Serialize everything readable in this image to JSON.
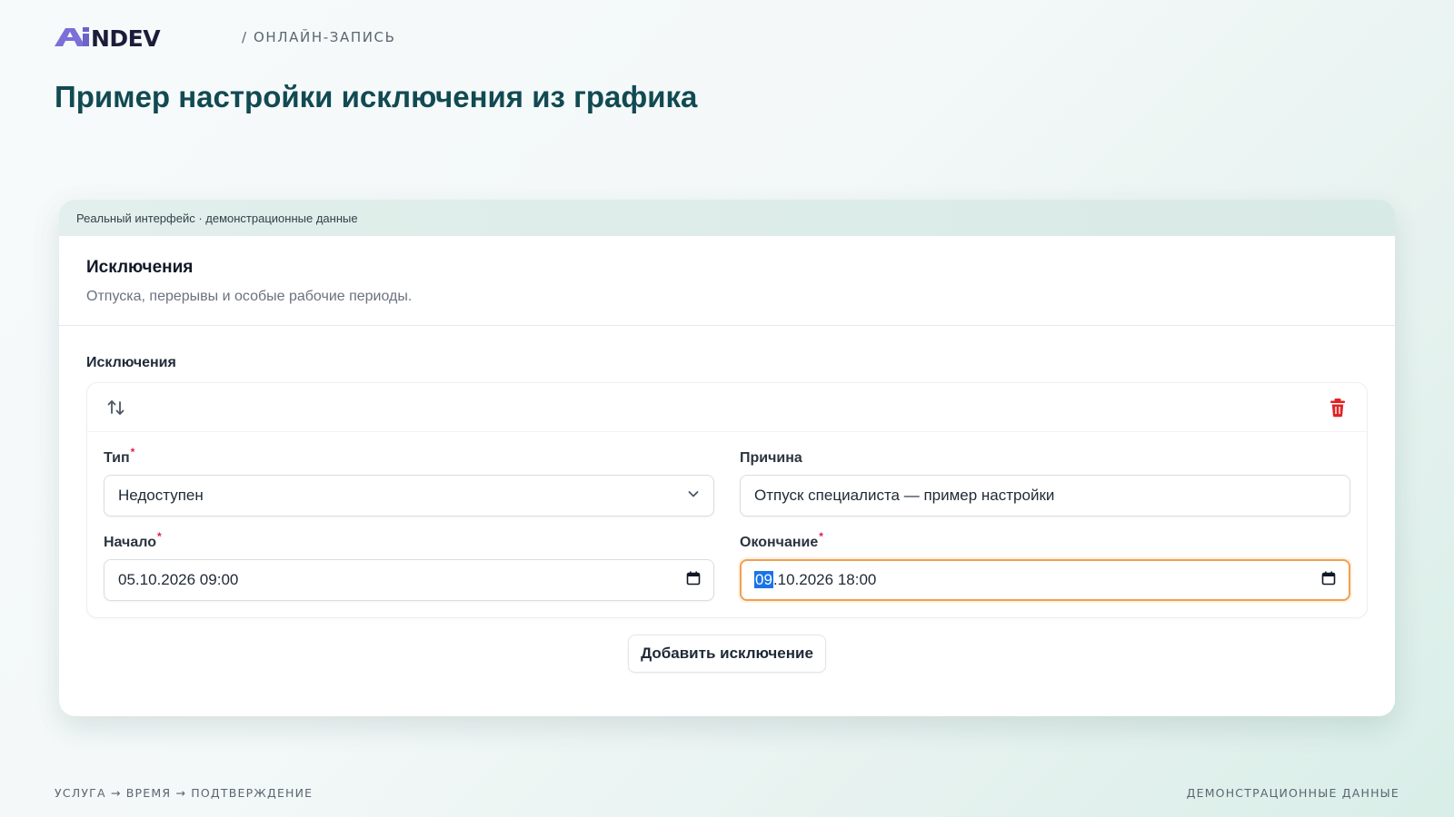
{
  "header": {
    "logo_text": "AiNDEV",
    "breadcrumb": "/ ОНЛАЙН-ЗАПИСЬ"
  },
  "page_title": "Пример настройки исключения из графика",
  "frame": {
    "caption": "Реальный интерфейс · демонстрационные данные"
  },
  "panel": {
    "title": "Исключения",
    "description": "Отпуска, перерывы и особые рабочие периоды."
  },
  "section": {
    "label": "Исключения",
    "toolbar": {
      "reorder_icon": "arrows-up-down-icon",
      "delete_icon": "trash-icon"
    },
    "fields": {
      "type": {
        "label": "Тип",
        "required_mark": "*",
        "value": "Недоступен"
      },
      "reason": {
        "label": "Причина",
        "value": "Отпуск специалиста — пример настройки"
      },
      "start": {
        "label": "Начало",
        "required_mark": "*",
        "value": "05.10.2026 09:00"
      },
      "end": {
        "label": "Окончание",
        "required_mark": "*",
        "value_selected": "09",
        "value_rest": ".10.2026 18:00"
      }
    },
    "add_button_label": "Добавить исключение"
  },
  "footer": {
    "left": "УСЛУГА → ВРЕМЯ → ПОДТВЕРЖДЕНИЕ",
    "right": "ДЕМОНСТРАЦИОННЫЕ ДАННЫЕ"
  },
  "colors": {
    "title": "#114a52",
    "logo_accent": "#7c6fd8",
    "logo_dark": "#1c1c3a",
    "focus_border": "#f0a050",
    "required": "#e11d48",
    "delete": "#e02424",
    "selection": "#1a73e8"
  }
}
